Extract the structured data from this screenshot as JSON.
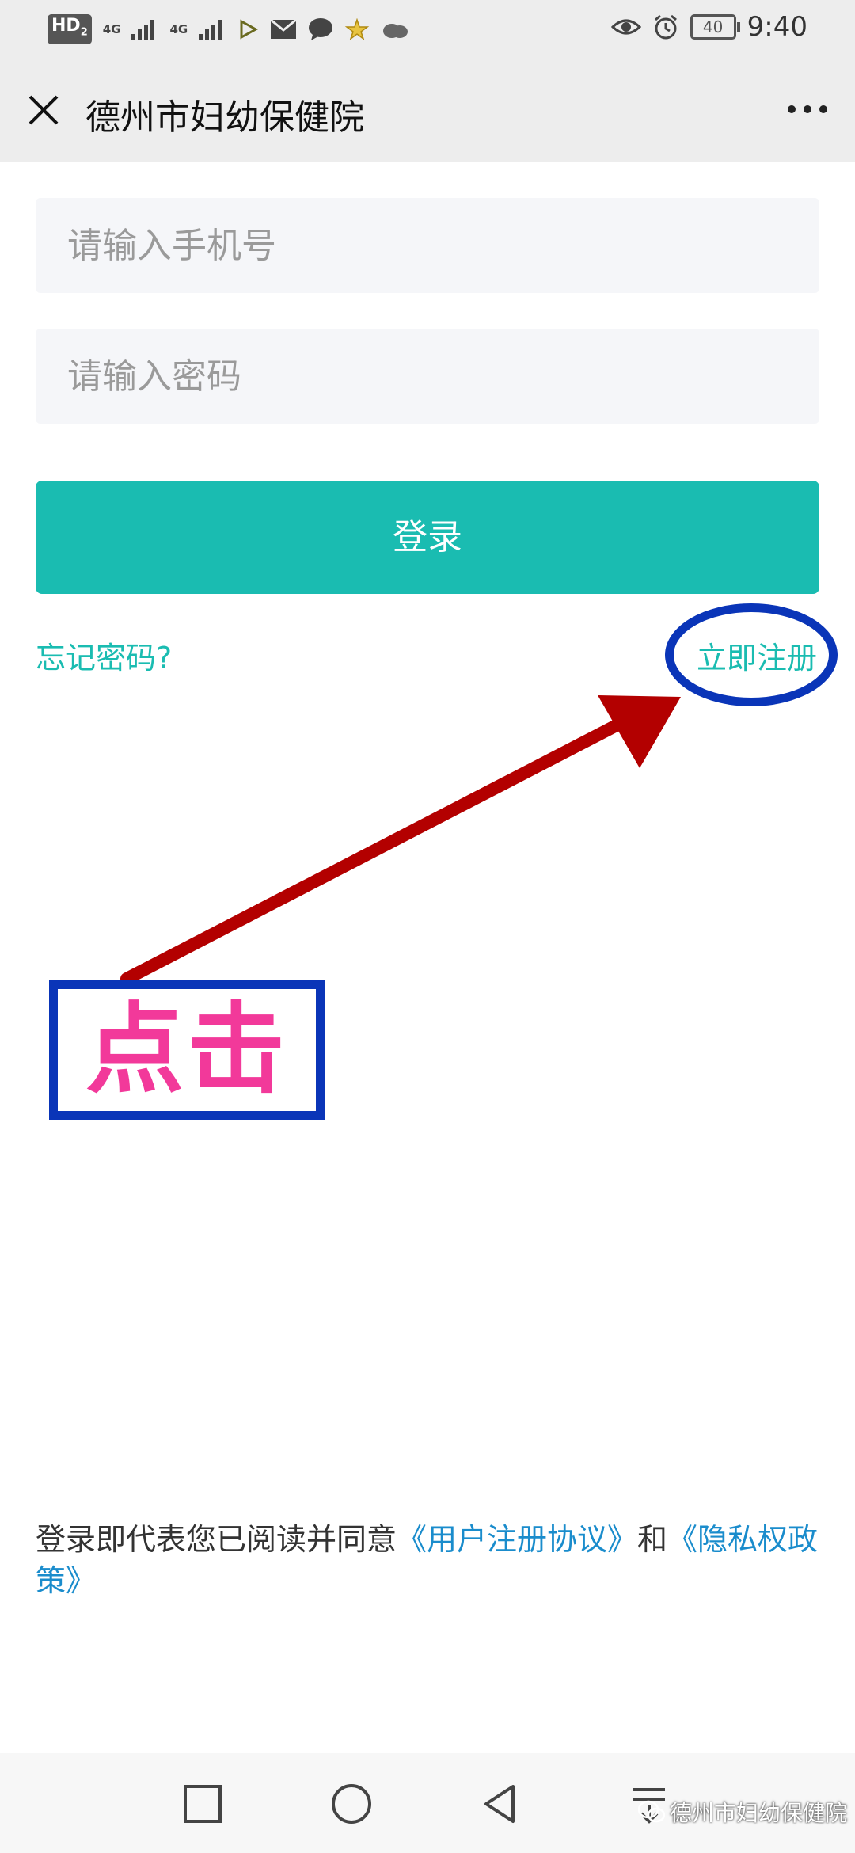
{
  "status_bar": {
    "hd_label": "HD",
    "hd_sub": "2",
    "net1": "4G",
    "net2": "4G",
    "battery": "40",
    "time": "9:40"
  },
  "nav": {
    "title": "德州市妇幼保健院"
  },
  "form": {
    "phone_placeholder": "请输入手机号",
    "password_placeholder": "请输入密码",
    "login_label": "登录",
    "forgot_label": "忘记密码?",
    "register_label": "立即注册"
  },
  "annotation": {
    "click_label": "点击",
    "colors": {
      "arrow": "#b30000",
      "outline": "#0a35b8",
      "text": "#f2399a"
    }
  },
  "agreement": {
    "prefix": "登录即代表您已阅读并同意",
    "user_agreement": "《用户注册协议》",
    "and": "和",
    "privacy_policy": "《隐私权政策》"
  },
  "watermark": {
    "text": "德州市妇幼保健院"
  },
  "colors": {
    "accent": "#1abcb1",
    "link": "#1a8ccc"
  }
}
